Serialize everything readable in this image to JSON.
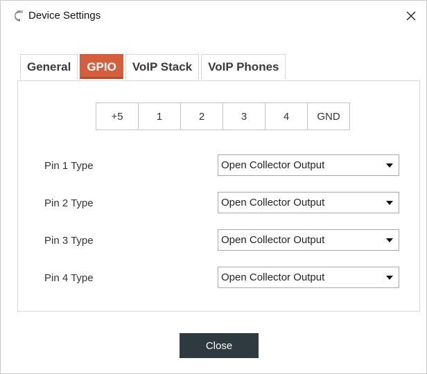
{
  "window": {
    "title": "Device Settings"
  },
  "tabs": [
    {
      "label": "General",
      "active": false
    },
    {
      "label": "GPIO",
      "active": true
    },
    {
      "label": "VoIP Stack",
      "active": false
    },
    {
      "label": "VoIP Phones",
      "active": false
    }
  ],
  "pins": [
    "+5",
    "1",
    "2",
    "3",
    "4",
    "GND"
  ],
  "pin_rows": [
    {
      "label": "Pin 1 Type",
      "value": "Open Collector Output"
    },
    {
      "label": "Pin 2 Type",
      "value": "Open Collector Output"
    },
    {
      "label": "Pin 3 Type",
      "value": "Open Collector Output"
    },
    {
      "label": "Pin 4 Type",
      "value": "Open Collector Output"
    }
  ],
  "footer": {
    "close_label": "Close"
  },
  "colors": {
    "accent": "#d35f3f",
    "button_bg": "#2f3a40"
  }
}
